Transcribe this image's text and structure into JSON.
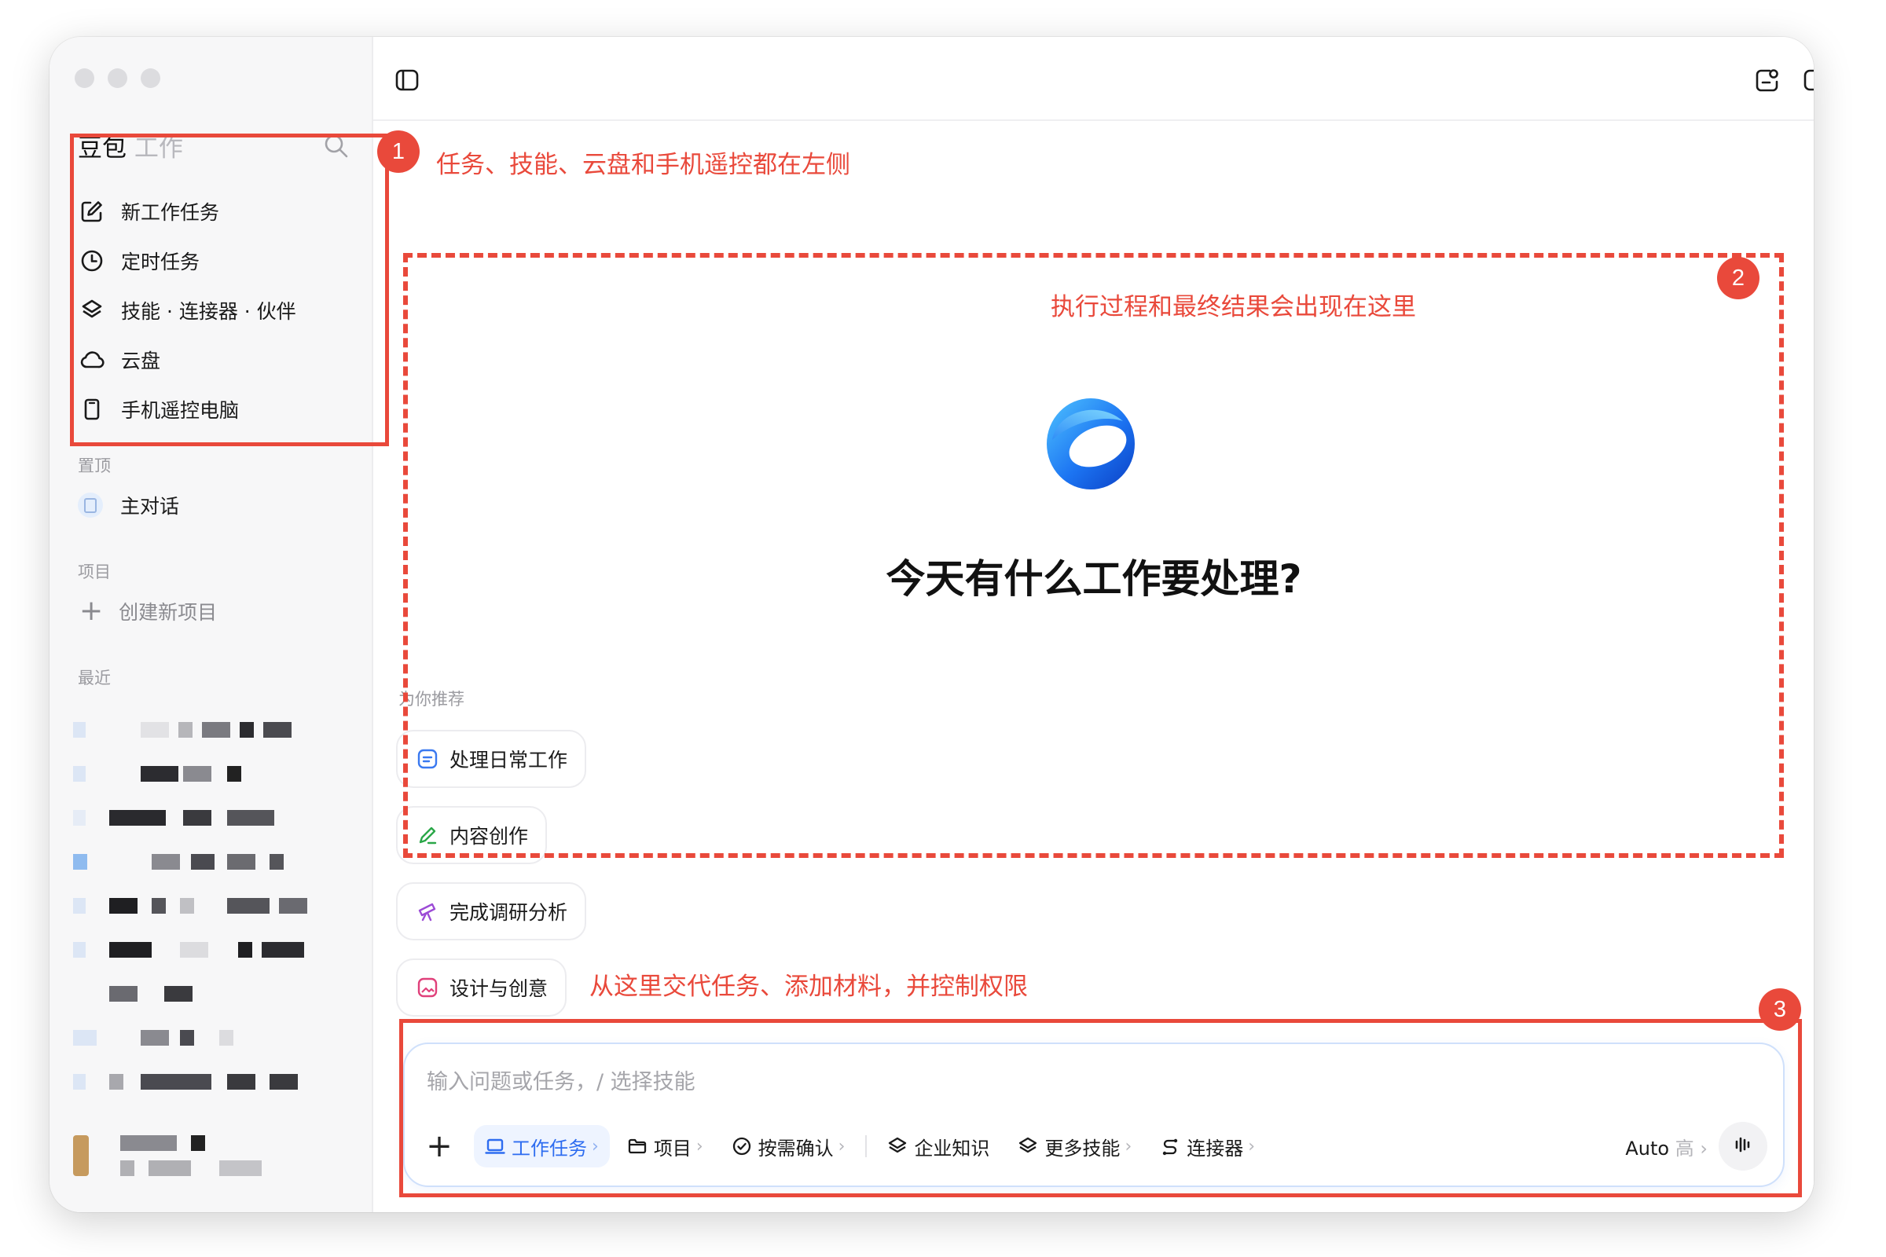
{
  "app": {
    "brand_main": "豆包",
    "brand_sub": "工作"
  },
  "sidebar": {
    "nav": [
      {
        "label": "新工作任务",
        "icon": "edit-icon"
      },
      {
        "label": "定时任务",
        "icon": "clock-icon"
      },
      {
        "label": "技能 · 连接器 · 伙伴",
        "icon": "layers-icon"
      },
      {
        "label": "云盘",
        "icon": "cloud-icon"
      },
      {
        "label": "手机遥控电脑",
        "icon": "phone-icon"
      }
    ],
    "pinned_title": "置顶",
    "pinned_items": [
      {
        "label": "主对话"
      }
    ],
    "projects_title": "项目",
    "new_project_label": "创建新项目",
    "recent_title": "最近"
  },
  "main": {
    "headline": "今天有什么工作要处理?",
    "recommend_title": "为你推荐",
    "chips": [
      {
        "label": "处理日常工作",
        "icon": "list-icon",
        "color": "#3a79f0"
      },
      {
        "label": "内容创作",
        "icon": "pen-icon",
        "color": "#2aa748"
      },
      {
        "label": "完成调研分析",
        "icon": "telescope-icon",
        "color": "#9c4bd6"
      },
      {
        "label": "设计与创意",
        "icon": "image-icon",
        "color": "#e0407a"
      }
    ]
  },
  "composer": {
    "placeholder": "输入问题或任务，/ 选择技能",
    "tools": [
      {
        "label": "工作任务",
        "chevron": "›"
      },
      {
        "label": "项目",
        "chevron": "›"
      },
      {
        "label": "按需确认",
        "chevron": "›"
      },
      {
        "label": "企业知识"
      },
      {
        "label": "更多技能",
        "chevron": "›"
      },
      {
        "label": "连接器",
        "chevron": "›"
      }
    ],
    "mode": "Auto",
    "mode_level": "高",
    "mode_chevron": "›"
  },
  "annotations": [
    {
      "number": "1",
      "text": "任务、技能、云盘和手机遥控都在左侧"
    },
    {
      "number": "2",
      "text": "执行过程和最终结果会出现在这里"
    },
    {
      "number": "3",
      "text": "从这里交代任务、添加材料，并控制权限"
    }
  ],
  "colors": {
    "annotation": "#e9493b",
    "accent": "#2d6cf0"
  }
}
